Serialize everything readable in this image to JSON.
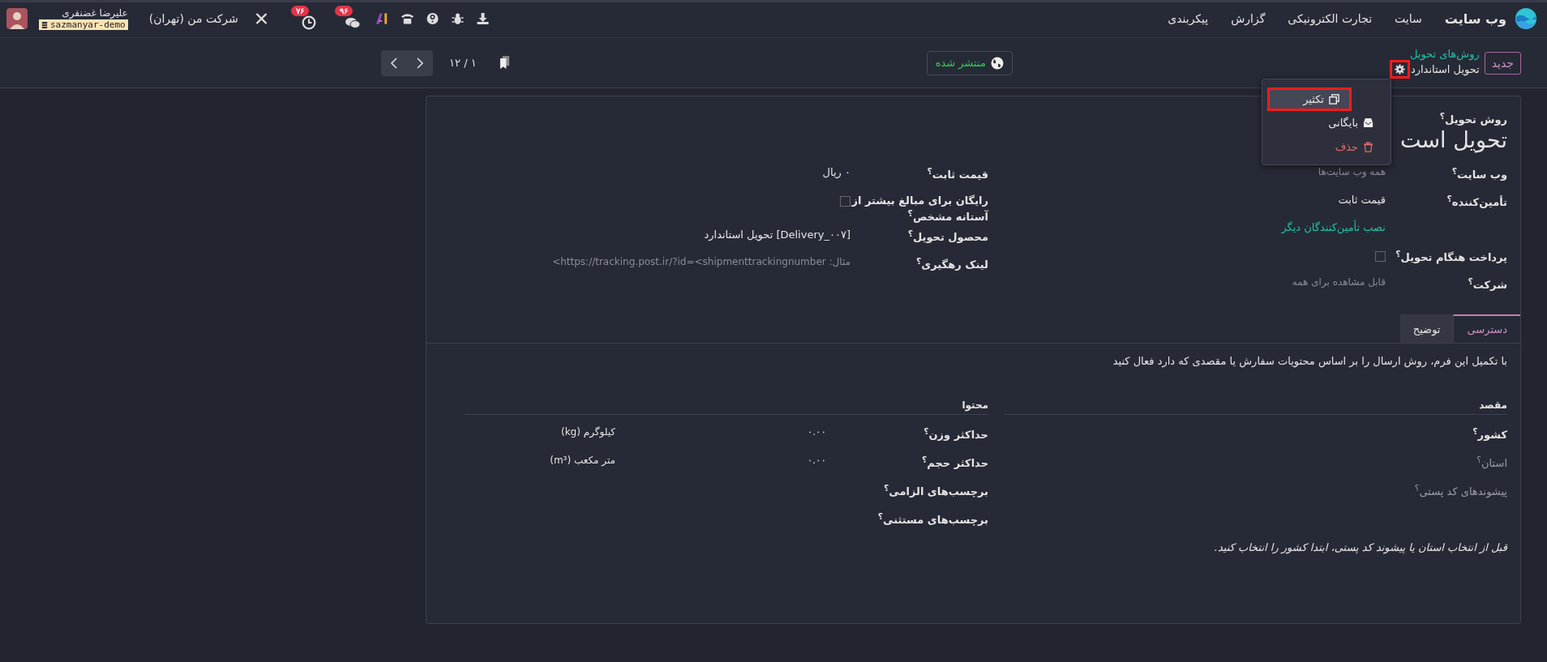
{
  "navbar": {
    "app_name": "وب سایت",
    "menus": [
      "سایت",
      "تجارت الکترونیکی",
      "گزارش",
      "پیکربندی"
    ],
    "message_count": "۹۶",
    "activity_count": "۷۶",
    "company": "شرکت من (تهران)",
    "user_name": "علیرضا غضنفری",
    "database": "sazmanyar-demo"
  },
  "control_panel": {
    "new_button": "جدید",
    "breadcrumb_parent": "روش‌های تحویل",
    "breadcrumb_current": "تحویل استاندارد",
    "gear_highlighted": true,
    "publish_label": "منتشر شده",
    "pager": "۱ / ۱۲"
  },
  "actions_menu": [
    {
      "kind": "duplicate",
      "label": "تکثیر",
      "selected": true
    },
    {
      "kind": "archive",
      "label": "بایگانی",
      "selected": false
    },
    {
      "kind": "delete",
      "label": "حذف",
      "selected": false
    }
  ],
  "form": {
    "label": "روش تحویل$^{؟}$",
    "title": "تحویل است",
    "right_fields": [
      {
        "kind": "placeholder",
        "label": "وب سایت$^{؟}$",
        "placeholder": "همه وب سایت‌ها"
      },
      {
        "kind": "text",
        "label": "تأمین‌کننده$^{؟}$",
        "value": "قیمت ثابت"
      },
      {
        "kind": "link",
        "value": "نصب تأمین‌کنندگان دیگر"
      },
      {
        "kind": "checkbox",
        "label": "پرداخت هنگام تحویل$^{؟}$",
        "checked": false
      },
      {
        "kind": "placeholder",
        "label": "شرکت$^{؟}$",
        "placeholder": "قابل مشاهده برای همه"
      }
    ],
    "left_fields": [
      {
        "kind": "text",
        "label": "قیمت ثابت$^{؟}$",
        "value": "۰ ریال"
      },
      {
        "kind": "checkbox",
        "label": "رایگان برای مبالغ بیشتر از آستانه مشخص$^{؟}$",
        "checked": false
      },
      {
        "kind": "text",
        "label": "محصول تحویل$^{؟}$",
        "value": "[Delivery_۰۰۷] تحویل استاندارد"
      },
      {
        "kind": "placeholder",
        "label": "لینک رهگیری$^{؟}$",
        "placeholder": "مثال: https://tracking.post.ir/?id=<shipmenttrackingnumber>"
      }
    ]
  },
  "tabs": [
    {
      "label": "دسترسی",
      "selected": true
    },
    {
      "label": "توضیح",
      "selected": false
    }
  ],
  "tab_content": {
    "intro": "با تکمیل این فرم، روش ارسال را بر اساس محتویات سفارش یا مقصدی که دارد فعال کنید",
    "destination": {
      "title": "مقصد",
      "fields": [
        {
          "label": "کشور$^{؟}$",
          "disabled": false
        },
        {
          "label": "استان$^{؟}$",
          "disabled": true
        },
        {
          "label": "پیشوندهای کد پستی$^{؟}$",
          "disabled": true
        }
      ],
      "note": "قبل از انتخاب استان یا پیشوند کد پستی، ابتدا کشور را انتخاب کنید."
    },
    "content": {
      "title": "محتوا",
      "fields": [
        {
          "label": "حداکثر وزن$^{؟}$",
          "value": "۰.۰۰",
          "unit": "کیلوگرم (kg)"
        },
        {
          "label": "حداکثر حجم$^{؟}$",
          "value": "۰.۰۰",
          "unit": "متر مکعب (m³)"
        },
        {
          "label": "برچسب‌های الزامی$^{؟}$"
        },
        {
          "label": "برچسب‌های مستثنی$^{؟}$"
        }
      ]
    }
  }
}
